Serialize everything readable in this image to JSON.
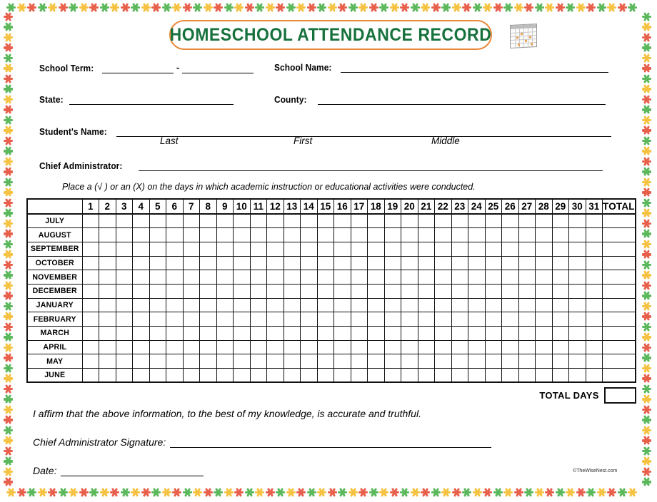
{
  "document": {
    "title": "HOMESCHOOL ATTENDANCE RECORD",
    "copyright": "©TheWiseNest.com",
    "icon": "calendar-icon"
  },
  "theme": {
    "title_color": "#16713c",
    "title_border_color": "#e8883a",
    "border_colors": [
      "#5cb85c",
      "#f5c242",
      "#e8604c"
    ],
    "disabled_cell_color": "#cdcdcb",
    "grid_color": "#111111"
  },
  "fields": {
    "school_term_label": "School Term:",
    "school_term_separator": "-",
    "school_term_value": "",
    "school_term_end_value": "",
    "school_name_label": "School Name:",
    "school_name_value": "",
    "state_label": "State:",
    "state_value": "",
    "county_label": "County:",
    "county_value": "",
    "student_name_label": "Student's Name:",
    "student_name_value": "",
    "sub_last": "Last",
    "sub_first": "First",
    "sub_middle": "Middle",
    "chief_admin_label": "Chief Administrator:",
    "chief_admin_value": ""
  },
  "instruction": "Place a (√ ) or an  (X) on the days in which academic instruction or educational activities were conducted.",
  "table": {
    "days": [
      "1",
      "2",
      "3",
      "4",
      "5",
      "6",
      "7",
      "8",
      "9",
      "10",
      "11",
      "12",
      "13",
      "14",
      "15",
      "16",
      "17",
      "18",
      "19",
      "20",
      "21",
      "22",
      "23",
      "24",
      "25",
      "26",
      "27",
      "28",
      "29",
      "30",
      "31"
    ],
    "total_header": "TOTAL",
    "months": [
      "JULY",
      "AUGUST",
      "SEPTEMBER",
      "OCTOBER",
      "NOVEMBER",
      "DECEMBER",
      "JANUARY",
      "FEBRUARY",
      "MARCH",
      "APRIL",
      "MAY",
      "JUNE"
    ],
    "disabled_days": {
      "JULY": [],
      "AUGUST": [],
      "SEPTEMBER": [
        31
      ],
      "OCTOBER": [],
      "NOVEMBER": [
        31
      ],
      "DECEMBER": [],
      "JANUARY": [],
      "FEBRUARY": [
        29,
        30,
        31
      ],
      "MARCH": [],
      "APRIL": [
        31
      ],
      "MAY": [],
      "JUNE": [
        31
      ]
    },
    "totals": [
      "",
      "",
      "",
      "",
      "",
      "",
      "",
      "",
      "",
      "",
      "",
      ""
    ],
    "total_days_label": "TOTAL DAYS",
    "total_days_value": ""
  },
  "footer": {
    "affirmation": "I affirm that the above information, to the best of my knowledge,  is accurate and truthful.",
    "signature_label": "Chief Administrator Signature:",
    "signature_value": "",
    "date_label": "Date:",
    "date_value": ""
  }
}
